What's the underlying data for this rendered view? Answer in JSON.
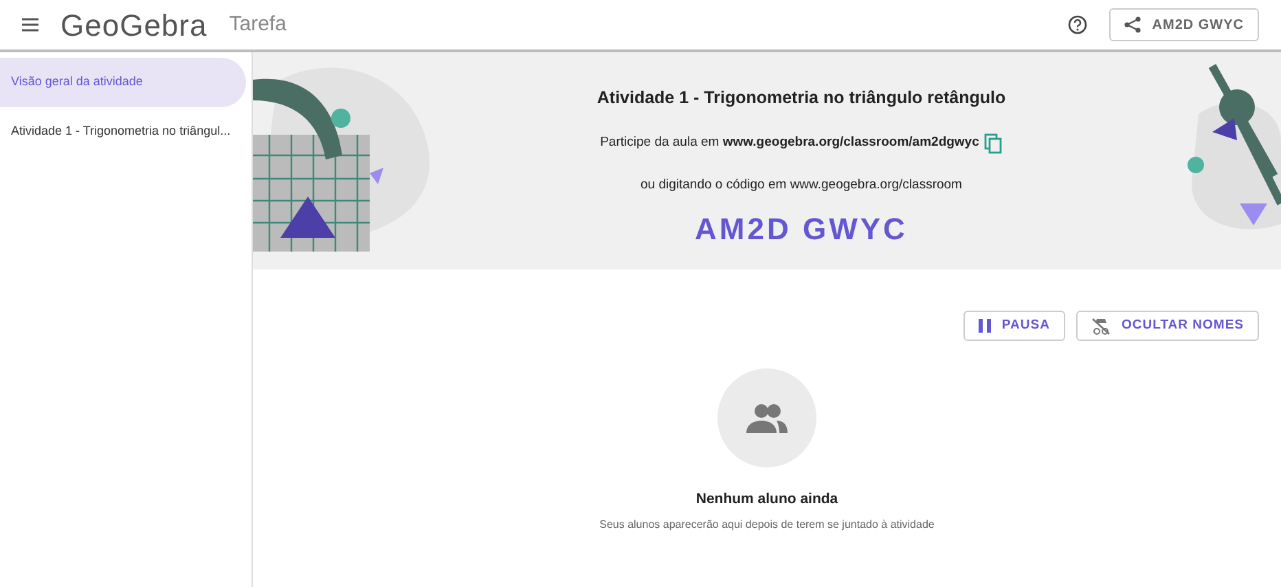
{
  "header": {
    "logo": "GeoGebra",
    "title": "Tarefa",
    "share_code": "AM2D GWYC"
  },
  "sidebar": {
    "items": [
      {
        "label": "Visão geral da atividade",
        "selected": true
      },
      {
        "label": "Atividade 1 - Trigonometria no triângul...",
        "selected": false
      }
    ]
  },
  "banner": {
    "title": "Atividade 1 - Trigonometria no triângulo retângulo",
    "join_text": "Participe da aula em **www.geogebra.org/classroom/am2dgwyc**",
    "code_text": "ou digitando o código em www.geogebra.org/classroom",
    "code": "AM2D GWYC"
  },
  "actions": [
    {
      "label": "PAUSA",
      "kind": "pause"
    },
    {
      "label": "OCULTAR NOMES",
      "kind": "hide-names"
    }
  ],
  "empty_state": {
    "title": "Nenhum aluno ainda",
    "subtitle": "Seus alunos aparecerão aqui depois de terem se juntado à atividade"
  }
}
